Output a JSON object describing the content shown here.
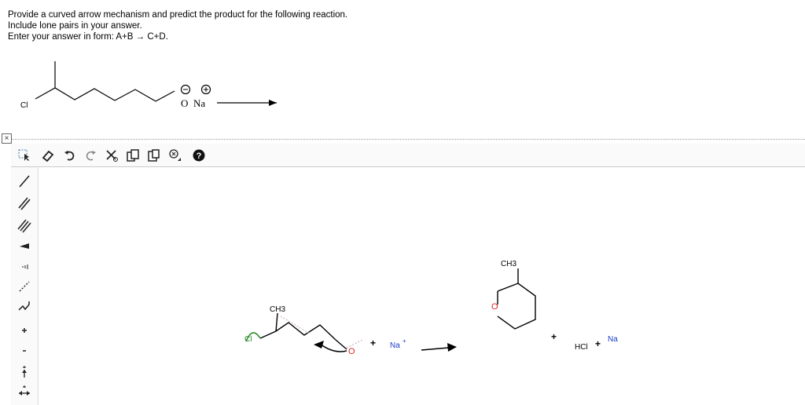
{
  "question": {
    "line1": "Provide a curved arrow mechanism and predict the product for the following reaction.",
    "line2": "Include lone pairs in your answer.",
    "line3": "Enter your answer in form: A+B → C+D."
  },
  "reaction": {
    "cl_label": "Cl",
    "o_label": "O",
    "na_label": "Na",
    "minus_sign": "−",
    "plus_sign": "+"
  },
  "editor": {
    "close_label": "×",
    "toolbar": [
      {
        "name": "select-tool-icon"
      },
      {
        "name": "eraser-icon"
      },
      {
        "name": "undo-icon"
      },
      {
        "name": "redo-icon"
      },
      {
        "name": "cut-icon"
      },
      {
        "name": "copy-icon"
      },
      {
        "name": "paste-icon"
      },
      {
        "name": "zoom-icon"
      },
      {
        "name": "help-icon"
      }
    ],
    "sidebar": [
      {
        "name": "single-bond-icon"
      },
      {
        "name": "double-bond-icon"
      },
      {
        "name": "triple-bond-icon"
      },
      {
        "name": "wedge-bond-icon"
      },
      {
        "name": "hash-bond-icon"
      },
      {
        "name": "dashed-bond-icon"
      },
      {
        "name": "chain-icon"
      },
      {
        "name": "positive-charge-icon"
      },
      {
        "name": "negative-charge-icon"
      },
      {
        "name": "reaction-arrow-icon"
      },
      {
        "name": "resonance-arrow-icon"
      }
    ],
    "canvas": {
      "reactant_ch3": "CH3",
      "reactant_o": "O",
      "plus1": "+",
      "na_ion": "Na",
      "na_charge": "+",
      "product_ch3": "CH3",
      "product_o": "O",
      "plus2": "+",
      "hcl": "HCl",
      "plus3": "+",
      "na2": "Na"
    }
  }
}
